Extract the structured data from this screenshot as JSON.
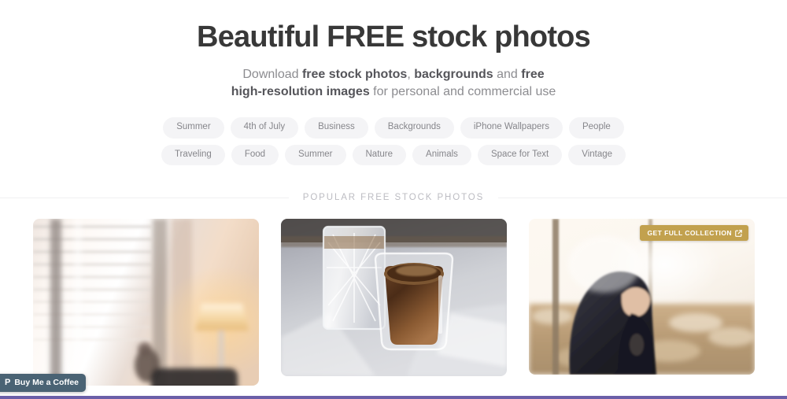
{
  "hero": {
    "title": "Beautiful FREE stock photos",
    "subtitle": {
      "part1": "Download ",
      "bold1": "free stock photos",
      "part2": ", ",
      "bold2": "backgrounds",
      "part3": " and ",
      "bold3": "free high-resolution images",
      "part4": " for personal and commercial use"
    }
  },
  "tags": {
    "row1": [
      {
        "label": "Summer"
      },
      {
        "label": "4th of July"
      },
      {
        "label": "Business"
      },
      {
        "label": "Backgrounds"
      },
      {
        "label": "iPhone Wallpapers"
      },
      {
        "label": "People"
      }
    ],
    "row2": [
      {
        "label": "Traveling"
      },
      {
        "label": "Food"
      },
      {
        "label": "Summer"
      },
      {
        "label": "Nature"
      },
      {
        "label": "Animals"
      },
      {
        "label": "Space for Text"
      },
      {
        "label": "Vintage"
      }
    ]
  },
  "section": {
    "heading": "POPULAR FREE STOCK PHOTOS"
  },
  "gallery": {
    "cards": [
      {
        "alt": "Blurred sunlit room interior with window blinds and a warm table lamp"
      },
      {
        "alt": "Double-wall glass of espresso coffee beside a cut-crystal glass of water in sunlight"
      },
      {
        "alt": "Person in dark hooded sweatshirt sitting on a swing backlit by bright sky"
      }
    ]
  },
  "badge": {
    "label": "GET FULL COLLECTION",
    "icon": "external-link-icon",
    "color": "#c2a14e"
  },
  "buy_me_a_coffee": {
    "label": "Buy Me a Coffee",
    "icon": "coffee-cup-icon",
    "icon_glyph": "P",
    "color": "#4a6374"
  },
  "bottom_bar": {
    "color": "#6b5fa8"
  },
  "colors": {
    "title": "#383838",
    "subtitle": "#8c8c90",
    "tag_bg": "#f4f4f6",
    "tag_text": "#86868b",
    "section_heading": "#bcbcc2",
    "divider": "#f0f0f1"
  }
}
